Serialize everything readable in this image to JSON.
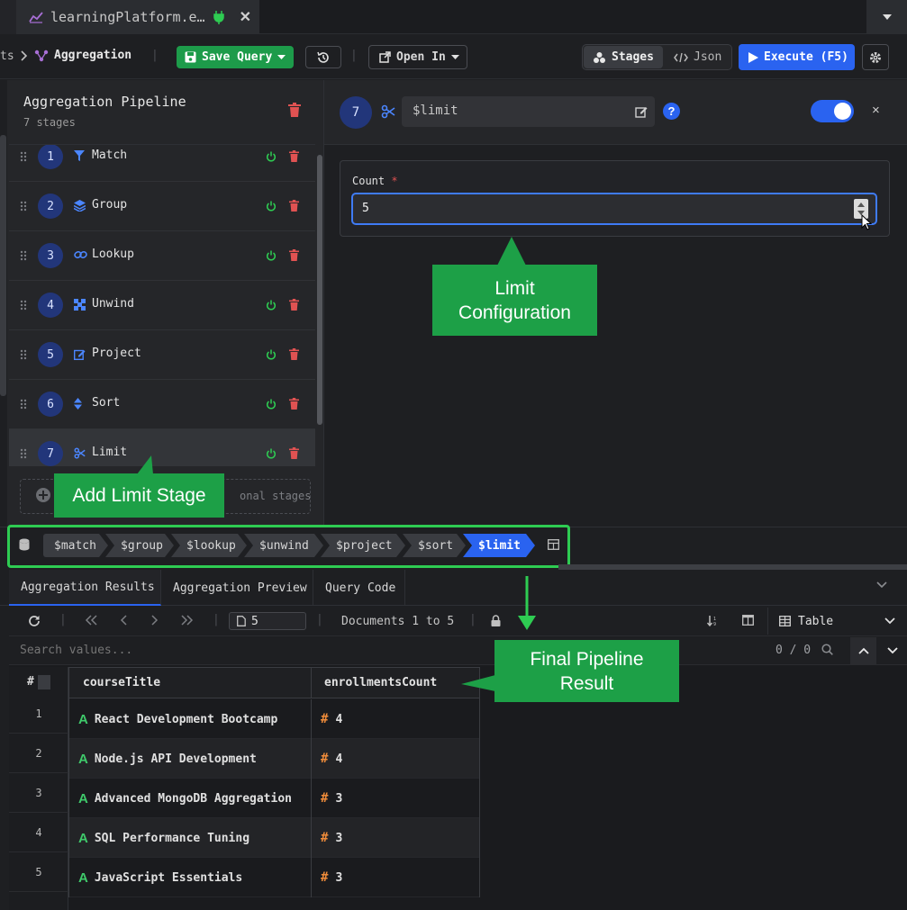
{
  "tab": {
    "title": "learningPlatform.e…"
  },
  "breadcrumb": {
    "prev": "ts",
    "current": "Aggregation"
  },
  "toolbar": {
    "save_label": "Save Query",
    "open_in_label": "Open In",
    "stages_label": "Stages",
    "json_label": "Json",
    "execute_label": "Execute (F5)"
  },
  "pipeline": {
    "title": "Aggregation Pipeline",
    "subtitle": "7 stages",
    "stages": [
      {
        "num": "1",
        "label": "Match",
        "icon": "filter-icon"
      },
      {
        "num": "2",
        "label": "Group",
        "icon": "layers-icon"
      },
      {
        "num": "3",
        "label": "Lookup",
        "icon": "link-icon"
      },
      {
        "num": "4",
        "label": "Unwind",
        "icon": "expand-icon"
      },
      {
        "num": "5",
        "label": "Project",
        "icon": "edit-icon"
      },
      {
        "num": "6",
        "label": "Sort",
        "icon": "sort-icon"
      },
      {
        "num": "7",
        "label": "Limit",
        "icon": "scissors-icon"
      }
    ],
    "add_stage_text": "onal stages"
  },
  "config": {
    "stage_num": "7",
    "stage_name": "$limit",
    "help": "?",
    "close": "×",
    "count_label": "Count",
    "required_mark": "*",
    "count_value": "5"
  },
  "chain": [
    "$match",
    "$group",
    "$lookup",
    "$unwind",
    "$project",
    "$sort",
    "$limit"
  ],
  "results": {
    "tabs": [
      "Aggregation Results",
      "Aggregation Preview",
      "Query Code"
    ],
    "page": "5",
    "documents_range": "Documents 1 to 5",
    "view": "Table",
    "search_placeholder": "Search values...",
    "search_count": "0 / 0",
    "row_header": "#",
    "columns": [
      "courseTitle",
      "enrollmentsCount"
    ],
    "rows": [
      {
        "n": "1",
        "courseTitle": "React Development Bootcamp",
        "enrollmentsCount": "4"
      },
      {
        "n": "2",
        "courseTitle": "Node.js API Development",
        "enrollmentsCount": "4"
      },
      {
        "n": "3",
        "courseTitle": "Advanced MongoDB Aggregation",
        "enrollmentsCount": "3"
      },
      {
        "n": "4",
        "courseTitle": "SQL Performance Tuning",
        "enrollmentsCount": "3"
      },
      {
        "n": "5",
        "courseTitle": "JavaScript Essentials",
        "enrollmentsCount": "3"
      }
    ]
  },
  "callouts": {
    "limit_config_line1": "Limit",
    "limit_config_line2": "Configuration",
    "add_limit": "Add Limit Stage",
    "final_line1": "Final Pipeline",
    "final_line2": "Result"
  },
  "colors": {
    "accent_blue": "#2a63f0",
    "save_green": "#1d9b4a",
    "callout_green": "#1da047",
    "highlight_green": "#2ecc52",
    "delete_red": "#e05252"
  }
}
